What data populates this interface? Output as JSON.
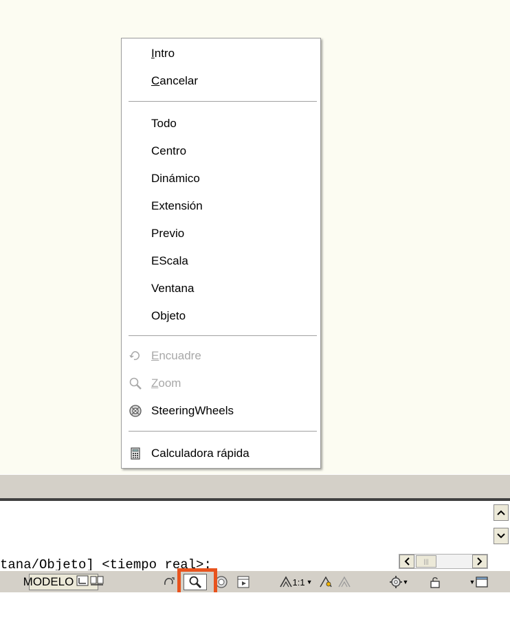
{
  "context_menu": {
    "items": [
      {
        "pre": "",
        "u": "I",
        "post": "ntro"
      },
      {
        "pre": "",
        "u": "C",
        "post": "ancelar"
      },
      {
        "pre": "Todo",
        "u": "",
        "post": ""
      },
      {
        "pre": "Centro",
        "u": "",
        "post": ""
      },
      {
        "pre": "Dinámico",
        "u": "",
        "post": ""
      },
      {
        "pre": "Extensión",
        "u": "",
        "post": ""
      },
      {
        "pre": "Previo",
        "u": "",
        "post": ""
      },
      {
        "pre": "EScala",
        "u": "",
        "post": ""
      },
      {
        "pre": "Ventana",
        "u": "",
        "post": ""
      },
      {
        "pre": "Objeto",
        "u": "",
        "post": ""
      },
      {
        "pre": "",
        "u": "E",
        "post": "ncuadre",
        "icon": "pan-icon",
        "disabled": true
      },
      {
        "pre": "",
        "u": "Z",
        "post": "oom",
        "icon": "zoom-icon",
        "disabled": true
      },
      {
        "pre": "SteeringWheels",
        "u": "",
        "post": "",
        "icon": "steeringwheels-icon"
      },
      {
        "pre": "Calculadora rápida",
        "u": "",
        "post": "",
        "icon": "calculator-icon"
      }
    ]
  },
  "command_line": {
    "text": "tana/Objeto] <tiempo real>:"
  },
  "status_bar": {
    "model_label": "MODELO",
    "annotation_scale": "1:1",
    "icons": [
      "layout-icon",
      "layout-tabs-icon",
      "pan-icon",
      "zoom-icon",
      "steeringwheels-icon",
      "showmotion-icon",
      "annotation-scale-icon",
      "annotation-visibility-icon",
      "auto-scale-icon",
      "workspace-gear-icon",
      "lock-icon",
      "clean-screen-icon"
    ]
  },
  "colors": {
    "highlight": "#e8531d",
    "drawing_bg": "#fcfcf2"
  }
}
